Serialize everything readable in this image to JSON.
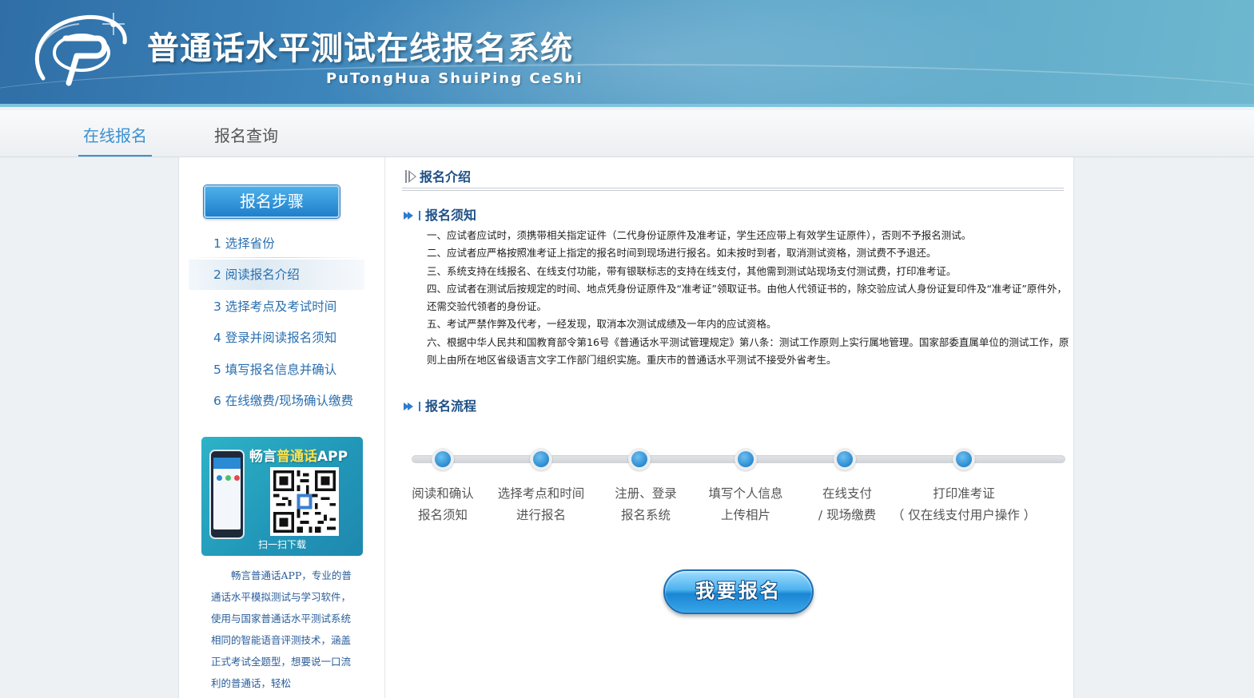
{
  "header": {
    "title": "普通话水平测试在线报名系统",
    "subtitle": "PuTongHua ShuiPing CeShi",
    "logo_icon": "putonghua-logo-icon"
  },
  "nav": {
    "items": [
      {
        "label": "在线报名",
        "active": true
      },
      {
        "label": "报名查询",
        "active": false
      }
    ]
  },
  "sidebar": {
    "steps_title": "报名步骤",
    "steps": [
      {
        "label": "1 选择省份"
      },
      {
        "label": "2 阅读报名介绍",
        "active": true
      },
      {
        "label": "3 选择考点及考试时间"
      },
      {
        "label": "4 登录并阅读报名须知"
      },
      {
        "label": "5 填写报名信息并确认"
      },
      {
        "label": "6 在线缴费/现场确认缴费"
      }
    ],
    "app": {
      "title_prefix": "畅言",
      "title_highlight": "普通话",
      "title_suffix": "APP",
      "scan_text": "扫一扫下载",
      "description": "畅言普通话APP，专业的普通话水平模拟测试与学习软件，使用与国家普通话水平测试系统相同的智能语音评测技术，涵盖正式考试全题型，想要说一口流利的普通话，轻松"
    }
  },
  "content": {
    "section_title": "报名介绍",
    "notice_title": "报名须知",
    "notice_items": [
      "一、应试者应试时，须携带相关指定证件（二代身份证原件及准考证，学生还应带上有效学生证原件），否则不予报名测试。",
      "二、应试者应严格按照准考证上指定的报名时间到现场进行报名。如未按时到者，取消测试资格，测试费不予退还。",
      "三、系统支持在线报名、在线支付功能，带有银联标志的支持在线支付，其他需到测试站现场支付测试费，打印准考证。",
      "四、应试者在测试后按规定的时间、地点凭身份证原件及“准考证”领取证书。由他人代领证书的，除交验应试人身份证复印件及“准考证”原件外，还需交验代领者的身份证。",
      "五、考试严禁作弊及代考，一经发现，取消本次测试成绩及一年内的应试资格。",
      "六、根据中华人民共和国教育部令第16号《普通话水平测试管理规定》第八条：测试工作原则上实行属地管理。国家部委直属单位的测试工作，原则上由所在地区省级语言文字工作部门组织实施。重庆市的普通话水平测试不接受外省考生。"
    ],
    "flow_title": "报名流程",
    "flow_steps": [
      {
        "line1": "阅读和确认",
        "line2": "报名须知"
      },
      {
        "line1": "选择考点和时间",
        "line2": "进行报名"
      },
      {
        "line1": "注册、登录",
        "line2": "报名系统"
      },
      {
        "line1": "填写个人信息",
        "line2": "上传相片"
      },
      {
        "line1": "在线支付",
        "line2": "/ 现场缴费"
      },
      {
        "line1": "打印准考证",
        "line2": "（ 仅在线支付用户操作 ）"
      }
    ],
    "register_button": "我要报名"
  },
  "colors": {
    "accent": "#3a90d0",
    "heading": "#1e4f86",
    "step_text": "#2a6fb0"
  }
}
